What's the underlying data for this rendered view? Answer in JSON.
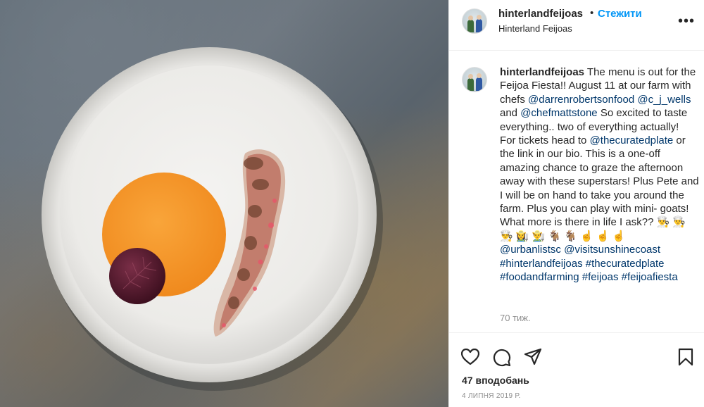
{
  "post": {
    "username": "hinterlandfeijoas",
    "separator": "•",
    "follow_label": "Стежити",
    "location": "Hinterland Feijoas",
    "more_label": "•••"
  },
  "caption": {
    "username": "hinterlandfeijoas",
    "t1": " The menu is out for the Feijoa Fiesta!! August 11 at our farm with chefs ",
    "m1": "@darrenrobertsonfood",
    "t2": " ",
    "m2": "@c_j_wells",
    "t3": " and ",
    "m3": "@chefmattstone",
    "t4": " So excited to taste everything.. two of everything actually!",
    "t5": "For tickets head to ",
    "m4": "@thecuratedplate",
    "t6": " or the link in our bio. This is a one-off amazing chance to graze the afternoon away with these superstars! Plus Pete and I will be on hand to take you around the farm. Plus you can play with mini- goats! What more is there in life I ask?? 👨‍🍳 👨‍🍳 👨‍🍳 👩‍🌾 👨‍🌾 🐐 🐐 ☝️ ☝️ ☝️",
    "m5": "@urbanlistsc",
    "t7": " ",
    "m6": "@visitsunshinecoast",
    "h1": "#hinterlandfeijoas",
    "t8": " ",
    "h2": "#thecuratedplate",
    "h3": "#foodandfarming",
    "t9": " ",
    "h4": "#feijoas",
    "t10": " ",
    "h5": "#feijoafiesta"
  },
  "time_ago": "70 тиж.",
  "likes_label": "47 вподобань",
  "date_label": "4 ЛИПНЯ 2019 Р.",
  "icons": {
    "like": "heart-icon",
    "comment": "comment-icon",
    "share": "paper-plane-icon",
    "save": "bookmark-icon",
    "more": "more-dots-icon"
  },
  "colors": {
    "follow": "#0095f6",
    "mention": "#00376b",
    "muted": "#8e8e8e"
  }
}
